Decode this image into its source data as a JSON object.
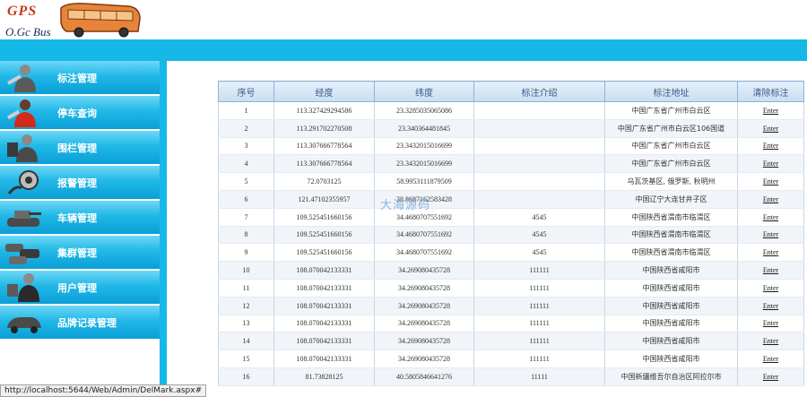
{
  "logo": {
    "text": "GPS",
    "subtitle": "O.Gc Bus"
  },
  "sidebar": {
    "items": [
      {
        "label": "标注管理",
        "icon": "user-wrench-icon"
      },
      {
        "label": "停车查询",
        "icon": "user-red-icon"
      },
      {
        "label": "围栏管理",
        "icon": "user-fence-icon"
      },
      {
        "label": "报警管理",
        "icon": "alarm-gauge-icon"
      },
      {
        "label": "车辆管理",
        "icon": "tank-vehicle-icon"
      },
      {
        "label": "集群管理",
        "icon": "vehicle-cluster-icon"
      },
      {
        "label": "用户管理",
        "icon": "user-group-icon"
      },
      {
        "label": "品牌记录管理",
        "icon": "car-brand-icon"
      }
    ]
  },
  "table": {
    "headers": [
      "序号",
      "经度",
      "纬度",
      "标注介绍",
      "标注地址",
      "清除标注"
    ],
    "rows": [
      [
        "1",
        "113.327429294586",
        "23.3285035065086",
        "",
        "中国广东省广州市白云区",
        "Enter"
      ],
      [
        "2",
        "113.291702270508",
        "23.340364481845",
        "",
        "中国广东省广州市白云区106国道",
        "Enter"
      ],
      [
        "3",
        "113.307666778564",
        "23.3432015016699",
        "",
        "中国广东省广州市白云区",
        "Enter"
      ],
      [
        "4",
        "113.307666778564",
        "23.3432015016699",
        "",
        "中国广东省广州市白云区",
        "Enter"
      ],
      [
        "5",
        "72.0703125",
        "58.9953111879509",
        "",
        "乌瓦茨基区, 俄罗斯, 秋明州",
        "Enter"
      ],
      [
        "6",
        "121.47102355957",
        "38.8687162583428",
        "",
        "中国辽宁大连甘井子区",
        "Enter"
      ],
      [
        "7",
        "109.525451660156",
        "34.4680707551692",
        "4545",
        "中国陕西省渭南市临渭区",
        "Enter"
      ],
      [
        "8",
        "109.525451660156",
        "34.4680707551692",
        "4545",
        "中国陕西省渭南市临渭区",
        "Enter"
      ],
      [
        "9",
        "109.525451660156",
        "34.4680707551692",
        "4545",
        "中国陕西省渭南市临渭区",
        "Enter"
      ],
      [
        "10",
        "108.070042133331",
        "34.269080435728",
        "111111",
        "中国陕西省咸阳市",
        "Enter"
      ],
      [
        "11",
        "108.070042133331",
        "34.269080435728",
        "111111",
        "中国陕西省咸阳市",
        "Enter"
      ],
      [
        "12",
        "108.070042133331",
        "34.269080435728",
        "111111",
        "中国陕西省咸阳市",
        "Enter"
      ],
      [
        "13",
        "108.070042133331",
        "34.269080435728",
        "111111",
        "中国陕西省咸阳市",
        "Enter"
      ],
      [
        "14",
        "108.070042133331",
        "34.269080435728",
        "111111",
        "中国陕西省咸阳市",
        "Enter"
      ],
      [
        "15",
        "108.070042133331",
        "34.269080435728",
        "111111",
        "中国陕西省咸阳市",
        "Enter"
      ],
      [
        "16",
        "81.73828125",
        "40.5805846641276",
        "11111",
        "中国新疆维吾尔自治区阿拉尔市",
        "Enter"
      ]
    ]
  },
  "watermark": "大海源码",
  "statusbar": {
    "url": "http://localhost:5644/Web/Admin/DelMark.aspx#"
  },
  "colors": {
    "accent": "#16b8e8",
    "header_border": "#8fb3d6"
  }
}
